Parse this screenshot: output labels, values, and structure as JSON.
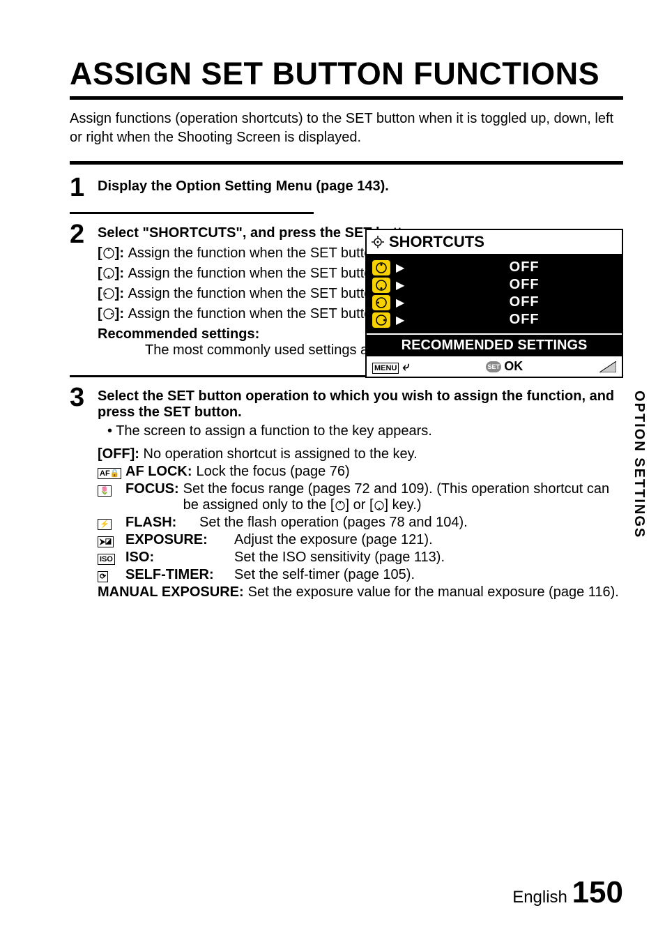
{
  "title": "ASSIGN SET BUTTON FUNCTIONS",
  "intro": "Assign functions (operation shortcuts) to the SET button when it is toggled up, down, left or right when the Shooting Screen is displayed.",
  "steps": {
    "s1": {
      "num": "1",
      "text": "Display the Option Setting Menu (page 143)."
    },
    "s2": {
      "num": "2",
      "heading": "Select \"SHORTCUTS\", and press the SET button.",
      "items": [
        "Assign the function when the SET button is toggled up.",
        "Assign the function when the SET button is toggled down.",
        "Assign the function when the SET button is toggled to the left.",
        "Assign the function when the SET button is toggled to the right."
      ],
      "rec_label": "Recommended settings:",
      "rec_text": "The most commonly used settings are automatically assigned."
    },
    "s3": {
      "num": "3",
      "heading": "Select the SET button operation to which you wish to assign the function, and press the SET button.",
      "bullet": "The screen to assign a function to the key appears.",
      "off_label": "[OFF]:",
      "off_text": "No operation shortcut is assigned to the key.",
      "options": {
        "aflock": {
          "label": "AF LOCK:",
          "text": "Lock the focus (page 76)"
        },
        "focus": {
          "label": "FOCUS:",
          "text1": "Set the focus range (pages 72 and 109). (This operation shortcut can be assigned only to the [",
          "text2": "] or [",
          "text3": "] key.)"
        },
        "flash": {
          "label": "FLASH:",
          "text": "Set the flash operation (pages 78 and 104)."
        },
        "expo": {
          "label": "EXPOSURE:",
          "text": "Adjust the exposure (page 121)."
        },
        "iso": {
          "label": "ISO:",
          "text": "Set the ISO sensitivity (page 113)."
        },
        "timer": {
          "label": "SELF-TIMER:",
          "text": "Set the self-timer (page 105)."
        },
        "manual": {
          "label": "MANUAL EXPOSURE:",
          "text": "Set the exposure value for the manual exposure (page 116)."
        }
      }
    }
  },
  "screen": {
    "title": "SHORTCUTS",
    "off": "OFF",
    "rec": "RECOMMENDED SETTINGS",
    "menu": "MENU",
    "set": "SET",
    "ok": "OK"
  },
  "side_tab": "OPTION SETTINGS",
  "footer_lang": "English",
  "footer_page": "150",
  "icons": {
    "bracket_open": "[",
    "bracket_close": "]:",
    "aflock": "AF🔒",
    "focus": "🌷",
    "flash": "⚡",
    "expo": "⮞◪",
    "iso": "ISO",
    "timer": "⟳"
  }
}
